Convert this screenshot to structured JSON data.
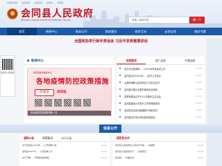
{
  "header": {
    "top_links": [
      "中国政府网",
      "省政府网",
      "市政府网",
      "简体版",
      "无障碍"
    ],
    "title": "会同县人民政府",
    "subtitle": "People's Government of Huitong County",
    "search_placeholder": "请输入搜索内容",
    "search_button": "搜一下"
  },
  "nav": [
    "首页",
    "新闻中心",
    "政务公开",
    "政务服务",
    "政民互动",
    "走进会同",
    "服务专题"
  ],
  "headline": "全国政协举行新年茶话会 习近平发表重要讲话",
  "floater": {
    "caption": "会同县人民政府"
  },
  "news_center": {
    "title": "新闻中心",
    "poster_badge": "会同县政务服务中心",
    "poster_title": "各地疫情防控政策措施",
    "poster_tag_1": "出发前",
    "poster_tag_2": "目的地",
    "caption": "各地疫情防控政策措施一览"
  },
  "news_tabs": [
    "会同要闻",
    "部门动态",
    "乡镇动态"
  ],
  "news_items": [
    {
      "title": "县长刘文胜调研……2022年项目建设工作",
      "date": "01-05"
    },
    {
      "title": "会同县召开2022年……经济工作会议",
      "date": "01-05"
    },
    {
      "title": "全县新冠肺炎疫情防控工作会议召开",
      "date": "01-04"
    },
    {
      "title": "会同县开展元旦春节期间安全检查",
      "date": "01-04"
    },
    {
      "title": "县委常委会召开2021年度民主生活会",
      "date": "01-04"
    },
    {
      "title": "会同县推进乡村振兴工作取得新成效",
      "date": "01-03"
    },
    {
      "title": "县领导走访慰问困难群众和老党员",
      "date": "01-03"
    },
    {
      "title": "会同县召开重点项目建设推进会",
      "date": "01-02"
    }
  ],
  "info_banner": "信息公开",
  "left_col": {
    "tabs": [
      "通知公告",
      "政策解读",
      "公示公告"
    ],
    "rows": [
      {
        "title": "关于会同县2022年……公开招聘公告",
        "date": "12-31"
      },
      {
        "title": "会同县2021年……人员名单公示",
        "date": "12-30"
      },
      {
        "title": "关于开展……专项整治的通知",
        "date": "12-29"
      }
    ]
  },
  "right_col": {
    "tabs": [
      "规范性文件"
    ],
    "rows": [
      {
        "title": "会同县人民政府办公室关于印发……的通知",
        "date": "12-31"
      },
      {
        "title": "会同县人民政府关于……实施意见",
        "date": "12-28"
      },
      {
        "title": "会同县……管理办法",
        "date": "12-20"
      }
    ]
  }
}
